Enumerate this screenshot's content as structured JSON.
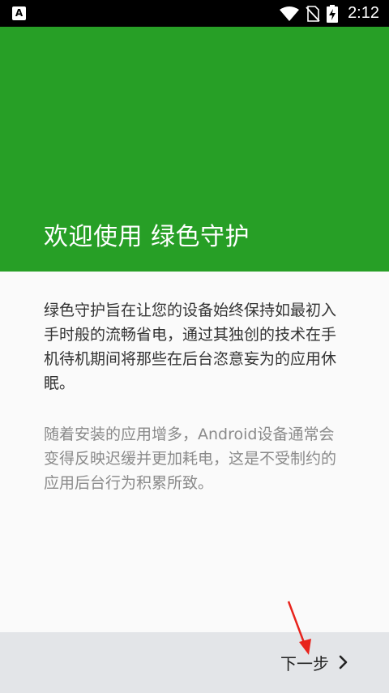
{
  "status_bar": {
    "notification_icon_letter": "A",
    "time": "2:12",
    "icons": [
      "notification-a-icon",
      "wifi-icon",
      "no-sim-icon",
      "battery-charging-icon"
    ]
  },
  "header": {
    "title": "欢迎使用 绿色守护",
    "background_color": "#279f26"
  },
  "content": {
    "paragraph1": "绿色守护旨在让您的设备始终保持如最初入手时般的流畅省电，通过其独创的技术在手机待机期间将那些在后台恣意妄为的应用休眠。",
    "paragraph2": "随着安装的应用增多，Android设备通常会变得反映迟缓并更加耗电，这是不受制约的应用后台行为积累所致。"
  },
  "footer": {
    "next_label": "下一步",
    "next_icon": "chevron-right-icon"
  },
  "annotation": {
    "arrow_color": "#e8231c"
  }
}
